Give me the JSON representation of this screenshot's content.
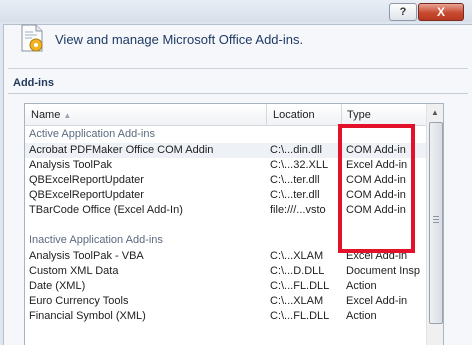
{
  "window": {
    "help_label": "?",
    "close_label": "X"
  },
  "header": {
    "title": "View and manage Microsoft Office Add-ins."
  },
  "section": {
    "label": "Add-ins"
  },
  "columns": {
    "name": "Name",
    "location": "Location",
    "type": "Type"
  },
  "groups": {
    "active": "Active Application Add-ins",
    "inactive": "Inactive Application Add-ins"
  },
  "active_rows": [
    {
      "name": "Acrobat PDFMaker Office COM Addin",
      "location": "C:\\...din.dll",
      "type": "COM Add-in"
    },
    {
      "name": "Analysis ToolPak",
      "location": "C:\\...32.XLL",
      "type": "Excel Add-in"
    },
    {
      "name": "QBExcelReportUpdater",
      "location": "C:\\...ter.dll",
      "type": "COM Add-in"
    },
    {
      "name": "QBExcelReportUpdater",
      "location": "C:\\...ter.dll",
      "type": "COM Add-in"
    },
    {
      "name": "TBarCode Office (Excel Add-In)",
      "location": "file:///...vsto",
      "type": "COM Add-in"
    }
  ],
  "inactive_rows": [
    {
      "name": "Analysis ToolPak - VBA",
      "location": "C:\\...XLAM",
      "type": "Excel Add-in"
    },
    {
      "name": "Custom XML Data",
      "location": "C:\\...D.DLL",
      "type": "Document Insp"
    },
    {
      "name": "Date (XML)",
      "location": "C:\\...FL.DLL",
      "type": "Action"
    },
    {
      "name": "Euro Currency Tools",
      "location": "C:\\...XLAM",
      "type": "Excel Add-in"
    },
    {
      "name": "Financial Symbol (XML)",
      "location": "C:\\...FL.DLL",
      "type": "Action"
    }
  ],
  "icons": {
    "header": "addins-gear-icon",
    "sort": "sort-ascending-icon",
    "scroll_up": "chevron-up-icon",
    "grip": "scroll-grip-icon"
  },
  "colors": {
    "highlight": "#e3122a",
    "close": "#c74a31",
    "title_text": "#1f3a66"
  }
}
